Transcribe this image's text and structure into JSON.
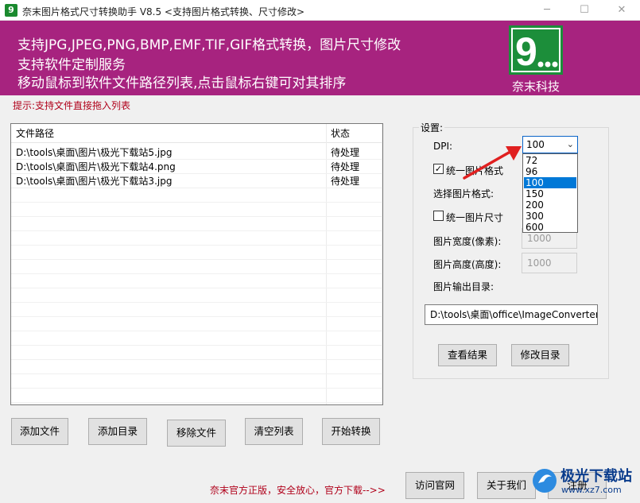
{
  "window": {
    "title": "奈末图片格式尺寸转换助手 V8.5  <支持图片格式转换、尺寸修改>",
    "icon_letter": "9",
    "controls": {
      "minimize": "─",
      "maximize": "☐",
      "close": "✕"
    }
  },
  "banner": {
    "lines": [
      "支持JPG,JPEG,PNG,BMP,EMF,TIF,GIF格式转换，图片尺寸修改",
      "支持软件定制服务",
      "移动鼠标到软件文件路径列表,点击鼠标右键可对其排序"
    ],
    "logo_glyph": "9...",
    "logo_text": "奈末科技"
  },
  "hint": "提示:支持文件直接拖入列表",
  "file_list": {
    "columns": [
      "文件路径",
      "状态"
    ],
    "rows": [
      {
        "path": "D:\\tools\\桌面\\图片\\极光下载站5.jpg",
        "status": "待处理"
      },
      {
        "path": "D:\\tools\\桌面\\图片\\极光下载站4.png",
        "status": "待处理"
      },
      {
        "path": "D:\\tools\\桌面\\图片\\极光下载站3.jpg",
        "status": "待处理"
      }
    ]
  },
  "actions": {
    "add_file": "添加文件",
    "add_dir": "添加目录",
    "remove_file": "移除文件",
    "clear_list": "清空列表",
    "start": "开始转换"
  },
  "settings": {
    "group_label": "设置:",
    "dpi_label": "DPI:",
    "dpi_value": "100",
    "dpi_options": [
      "72",
      "96",
      "100",
      "150",
      "200",
      "300",
      "600"
    ],
    "dpi_selected_index": 2,
    "unify_format_label": "统一图片格式",
    "unify_format_checked": true,
    "select_format_label": "选择图片格式:",
    "unify_size_label": "统一图片尺寸",
    "unify_size_checked": false,
    "width_label": "图片宽度(像素):",
    "width_value": "1000",
    "height_label": "图片高度(高度):",
    "height_value": "1000",
    "output_dir_label": "图片输出目录:",
    "output_dir_value": "D:\\tools\\桌面\\office\\ImageConverter",
    "view_result": "查看结果",
    "change_dir": "修改目录"
  },
  "footer": {
    "promo": "奈末官方正版，安全放心，官方下载-->>",
    "visit_site": "访问官网",
    "about": "关于我们",
    "register": "注册"
  },
  "watermark": {
    "text": "极光下载站",
    "url": "www.xz7.com"
  },
  "colors": {
    "banner": "#a7237f",
    "logo": "#1c8e3a",
    "hint_red": "#b0001a",
    "selection_blue": "#0078d7",
    "arrow_red": "#e02020"
  }
}
